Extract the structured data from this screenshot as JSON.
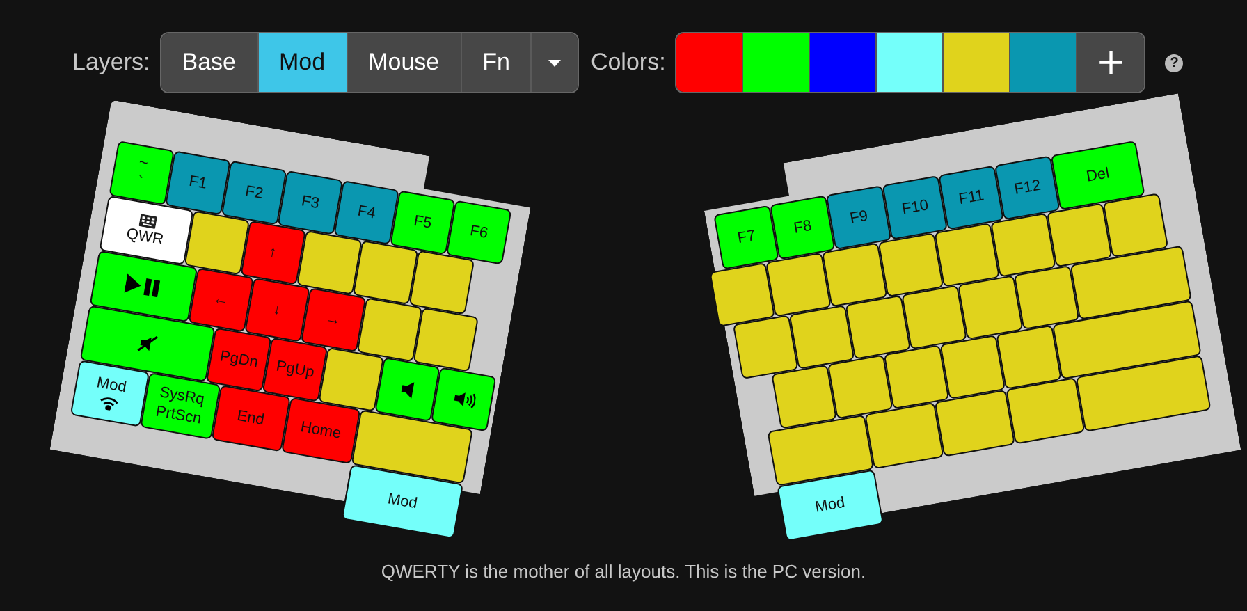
{
  "toolbar": {
    "layers_label": "Layers:",
    "layers": [
      {
        "label": "Base",
        "selected": false
      },
      {
        "label": "Mod",
        "selected": true
      },
      {
        "label": "Mouse",
        "selected": false
      },
      {
        "label": "Fn",
        "selected": false
      }
    ],
    "colors_label": "Colors:",
    "palette": [
      {
        "color": "#ff0000"
      },
      {
        "color": "#00ff00"
      },
      {
        "color": "#0000ff"
      },
      {
        "color": "#74fffa"
      },
      {
        "color": "#e0d31c"
      },
      {
        "color": "#0a97b0"
      }
    ],
    "add_label": "+",
    "help": "?"
  },
  "keyboard": {
    "left": [
      [
        {
          "kind": "text",
          "label": "~",
          "sublabel": "`",
          "color": "#00ff00"
        },
        {
          "kind": "text",
          "label": "F1",
          "color": "#0a97b0"
        },
        {
          "kind": "text",
          "label": "F2",
          "color": "#0a97b0"
        },
        {
          "kind": "text",
          "label": "F3",
          "color": "#0a97b0"
        },
        {
          "kind": "text",
          "label": "F4",
          "color": "#0a97b0"
        },
        {
          "kind": "text",
          "label": "F5",
          "color": "#00ff00"
        },
        {
          "kind": "text",
          "label": "F6",
          "color": "#00ff00"
        }
      ],
      [
        {
          "kind": "keyboard",
          "label": "QWR",
          "color": "#ffffff"
        },
        {
          "kind": "blank",
          "color": "#e0d31c"
        },
        {
          "kind": "text",
          "label": "↑",
          "color": "#ff0000"
        },
        {
          "kind": "blank",
          "color": "#e0d31c"
        },
        {
          "kind": "blank",
          "color": "#e0d31c"
        },
        {
          "kind": "blank",
          "color": "#e0d31c"
        }
      ],
      [
        {
          "kind": "playpause",
          "color": "#00ff00"
        },
        {
          "kind": "text",
          "label": "←",
          "color": "#ff0000"
        },
        {
          "kind": "text",
          "label": "↓",
          "color": "#ff0000"
        },
        {
          "kind": "text",
          "label": "→",
          "color": "#ff0000"
        },
        {
          "kind": "blank",
          "color": "#e0d31c"
        },
        {
          "kind": "blank",
          "color": "#e0d31c"
        }
      ],
      [
        {
          "kind": "mute",
          "color": "#00ff00"
        },
        {
          "kind": "text",
          "label": "PgDn",
          "color": "#ff0000"
        },
        {
          "kind": "text",
          "label": "PgUp",
          "color": "#ff0000"
        },
        {
          "kind": "blank",
          "color": "#e0d31c"
        },
        {
          "kind": "voldown",
          "color": "#00ff00"
        },
        {
          "kind": "volup",
          "color": "#00ff00"
        }
      ],
      [
        {
          "kind": "signal",
          "label": "Mod",
          "color": "#74fffa"
        },
        {
          "kind": "text",
          "label": "SysRq",
          "sublabel": "PrtScn",
          "color": "#00ff00"
        },
        {
          "kind": "text",
          "label": "End",
          "color": "#ff0000"
        },
        {
          "kind": "text",
          "label": "Home",
          "color": "#ff0000"
        },
        {
          "kind": "blank",
          "color": "#e0d31c"
        }
      ],
      [
        {
          "kind": "text",
          "label": "Mod",
          "color": "#74fffa"
        }
      ]
    ],
    "right": [
      [
        {
          "kind": "text",
          "label": "F7",
          "color": "#00ff00"
        },
        {
          "kind": "text",
          "label": "F8",
          "color": "#00ff00"
        },
        {
          "kind": "text",
          "label": "F9",
          "color": "#0a97b0"
        },
        {
          "kind": "text",
          "label": "F10",
          "color": "#0a97b0"
        },
        {
          "kind": "text",
          "label": "F11",
          "color": "#0a97b0"
        },
        {
          "kind": "text",
          "label": "F12",
          "color": "#0a97b0"
        },
        {
          "kind": "text",
          "label": "Del",
          "color": "#00ff00"
        }
      ],
      [
        {
          "kind": "blank",
          "color": "#e0d31c"
        },
        {
          "kind": "blank",
          "color": "#e0d31c"
        },
        {
          "kind": "blank",
          "color": "#e0d31c"
        },
        {
          "kind": "blank",
          "color": "#e0d31c"
        },
        {
          "kind": "blank",
          "color": "#e0d31c"
        },
        {
          "kind": "blank",
          "color": "#e0d31c"
        },
        {
          "kind": "blank",
          "color": "#e0d31c"
        },
        {
          "kind": "blank",
          "color": "#e0d31c"
        }
      ],
      [
        {
          "kind": "blank",
          "color": "#e0d31c"
        },
        {
          "kind": "blank",
          "color": "#e0d31c"
        },
        {
          "kind": "blank",
          "color": "#e0d31c"
        },
        {
          "kind": "blank",
          "color": "#e0d31c"
        },
        {
          "kind": "blank",
          "color": "#e0d31c"
        },
        {
          "kind": "blank",
          "color": "#e0d31c"
        },
        {
          "kind": "blank",
          "color": "#e0d31c"
        }
      ],
      [
        {
          "kind": "blank",
          "color": "#e0d31c"
        },
        {
          "kind": "blank",
          "color": "#e0d31c"
        },
        {
          "kind": "blank",
          "color": "#e0d31c"
        },
        {
          "kind": "blank",
          "color": "#e0d31c"
        },
        {
          "kind": "blank",
          "color": "#e0d31c"
        },
        {
          "kind": "blank",
          "color": "#e0d31c"
        }
      ],
      [
        {
          "kind": "blank",
          "color": "#e0d31c"
        },
        {
          "kind": "blank",
          "color": "#e0d31c"
        },
        {
          "kind": "blank",
          "color": "#e0d31c"
        },
        {
          "kind": "blank",
          "color": "#e0d31c"
        },
        {
          "kind": "blank",
          "color": "#e0d31c"
        }
      ],
      [
        {
          "kind": "text",
          "label": "Mod",
          "color": "#74fffa"
        }
      ]
    ]
  },
  "description": "QWERTY is the mother of all layouts. This is the PC version."
}
